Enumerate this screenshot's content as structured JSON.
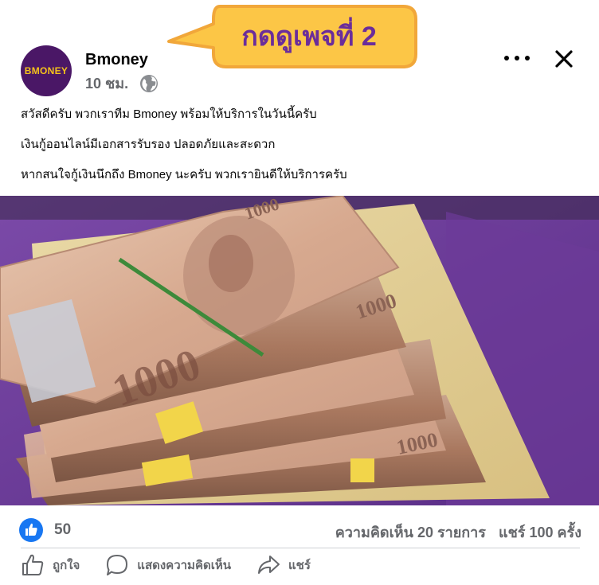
{
  "callout": {
    "text": "กดดูเพจที่ 2",
    "bg": "#fcc646",
    "border": "#f1a73a",
    "text_color": "#6b2d9a"
  },
  "header": {
    "avatar": {
      "text": "BMONEY",
      "bg": "#4a1766",
      "accent": "#f5c31b"
    },
    "page_name": "Bmoney",
    "time": "10 ชม.",
    "privacy_icon": "globe-icon",
    "more_icon": "more-horizontal-icon",
    "close_icon": "close-icon"
  },
  "post": {
    "lines": [
      "สวัสดีครับ พวกเราทีม Bmoney พร้อมให้บริการในวันนี้ครับ",
      "เงินกู้ออนไลน์มีเอกสารรับรอง ปลอดภัยและสะดวก",
      "หากสนใจกู้เงินนึกถึง Bmoney นะครับ พวกเรายินดีให้บริการครับ"
    ]
  },
  "photo": {
    "label": "1000"
  },
  "footer": {
    "reaction_count": "50",
    "comments": "ความคิดเห็น 20 รายการ",
    "shares": "แชร์ 100 ครั้ง",
    "actions": {
      "like": "ถูกใจ",
      "comment": "แสดงความคิดเห็น",
      "share": "แชร์"
    },
    "like_color": "#1877f2"
  }
}
